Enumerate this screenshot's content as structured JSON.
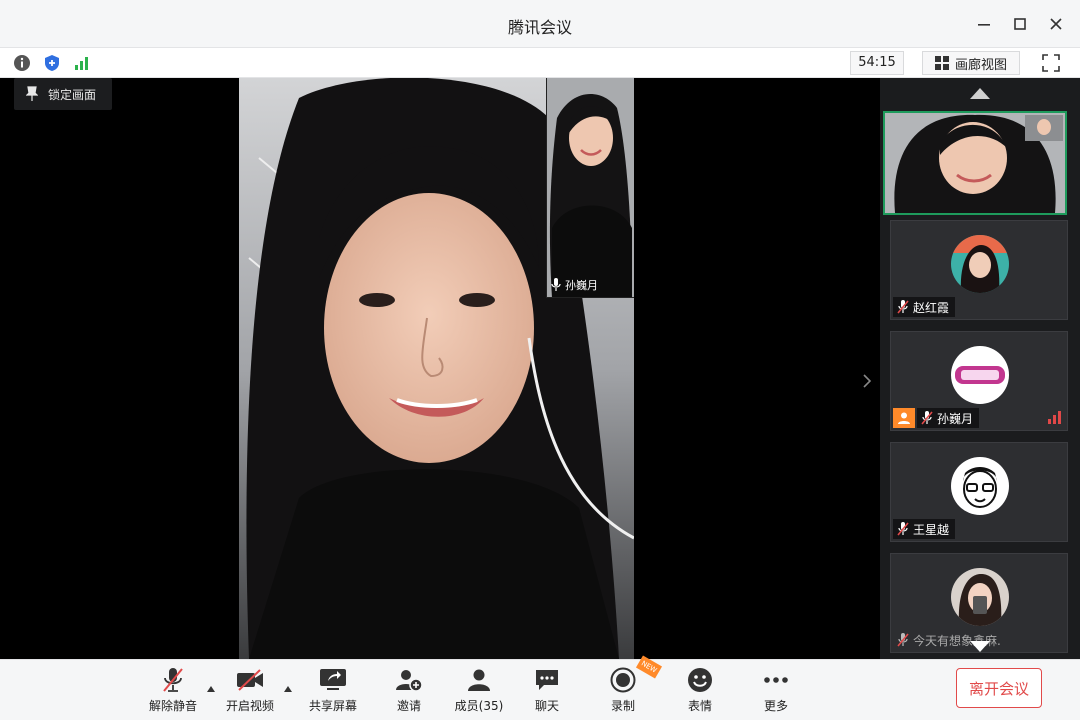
{
  "window": {
    "title": "腾讯会议"
  },
  "info_bar": {
    "timer": "54:15",
    "gallery_label": "画廊视图"
  },
  "stage": {
    "lock_label": "锁定画面",
    "pip_name": "孙巍月"
  },
  "participants": [
    {
      "name": "赵红霞",
      "muted": true,
      "host": false
    },
    {
      "name": "孙巍月",
      "muted": true,
      "host": true,
      "signal": true
    },
    {
      "name": "王星越",
      "muted": true,
      "host": false
    },
    {
      "name": "今天有想象鑫麻.",
      "muted": true,
      "host": false
    }
  ],
  "toolbar": {
    "unmute_label": "解除静音",
    "video_label": "开启视频",
    "share_label": "共享屏幕",
    "invite_label": "邀请",
    "members_label": "成员(35)",
    "chat_label": "聊天",
    "record_label": "录制",
    "new_badge": "NEW",
    "emoji_label": "表情",
    "more_label": "更多",
    "leave_label": "离开会议"
  },
  "colors": {
    "accent_green": "#1e9b5c",
    "leave_red": "#e14a4a",
    "host_orange": "#ff8a2a",
    "signal_green": "#2bb24c"
  }
}
